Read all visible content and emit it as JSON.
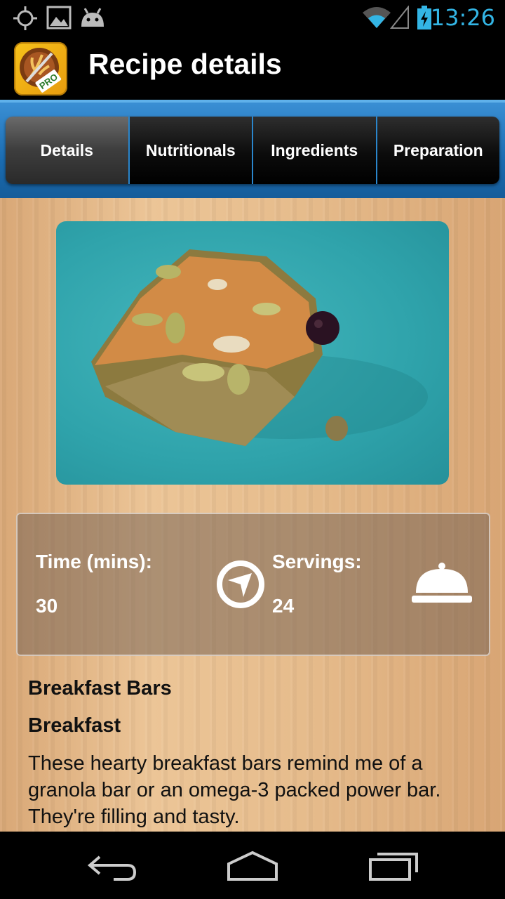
{
  "status_bar": {
    "time": "13:26",
    "icons": [
      "gps-icon",
      "image-icon",
      "android-icon",
      "wifi-icon",
      "signal-icon",
      "battery-charging-icon"
    ]
  },
  "action_bar": {
    "title": "Recipe details",
    "app_icon_badge": "PRO"
  },
  "tabs": [
    {
      "label": "Details",
      "active": true
    },
    {
      "label": "Nutritionals",
      "active": false
    },
    {
      "label": "Ingredients",
      "active": false
    },
    {
      "label": "Preparation",
      "active": false
    }
  ],
  "info": {
    "time_label": "Time (mins):",
    "time_value": "30",
    "servings_label": "Servings:",
    "servings_value": "24",
    "time_icon": "compass-clock-icon",
    "servings_icon": "serving-cloche-icon"
  },
  "recipe": {
    "name": "Breakfast Bars",
    "category": "Breakfast",
    "description": "These hearty breakfast bars remind me of a granola bar or an omega-3 packed power bar.  They're filling and tasty."
  },
  "nav_bar": {
    "icons": [
      "back-icon",
      "home-icon",
      "recents-icon"
    ]
  },
  "colors": {
    "accent_blue": "#33b5e5",
    "tab_band": "#1a6bb0"
  }
}
